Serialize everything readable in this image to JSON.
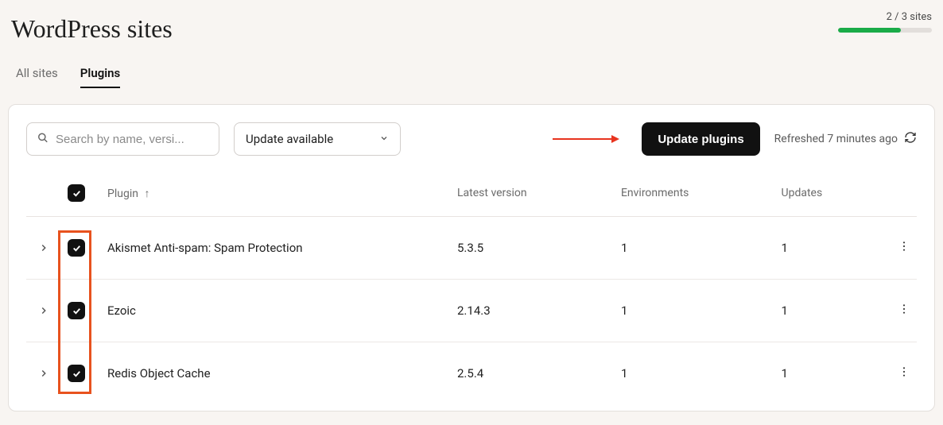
{
  "header": {
    "title": "WordPress sites",
    "progress_label": "2 / 3 sites",
    "progress_percent": 66.66
  },
  "tabs": {
    "all_sites": "All sites",
    "plugins": "Plugins"
  },
  "toolbar": {
    "search_placeholder": "Search by name, versi...",
    "filter_value": "Update available",
    "update_button": "Update plugins",
    "refreshed_label": "Refreshed 7 minutes ago"
  },
  "columns": {
    "plugin": "Plugin",
    "latest_version": "Latest version",
    "environments": "Environments",
    "updates": "Updates"
  },
  "rows": [
    {
      "name": "Akismet Anti-spam: Spam Protection",
      "latest": "5.3.5",
      "environments": "1",
      "updates": "1"
    },
    {
      "name": "Ezoic",
      "latest": "2.14.3",
      "environments": "1",
      "updates": "1"
    },
    {
      "name": "Redis Object Cache",
      "latest": "2.5.4",
      "environments": "1",
      "updates": "1"
    }
  ],
  "annotation": {
    "arrow_color": "#e8341f",
    "highlight_color": "#e8521e"
  }
}
